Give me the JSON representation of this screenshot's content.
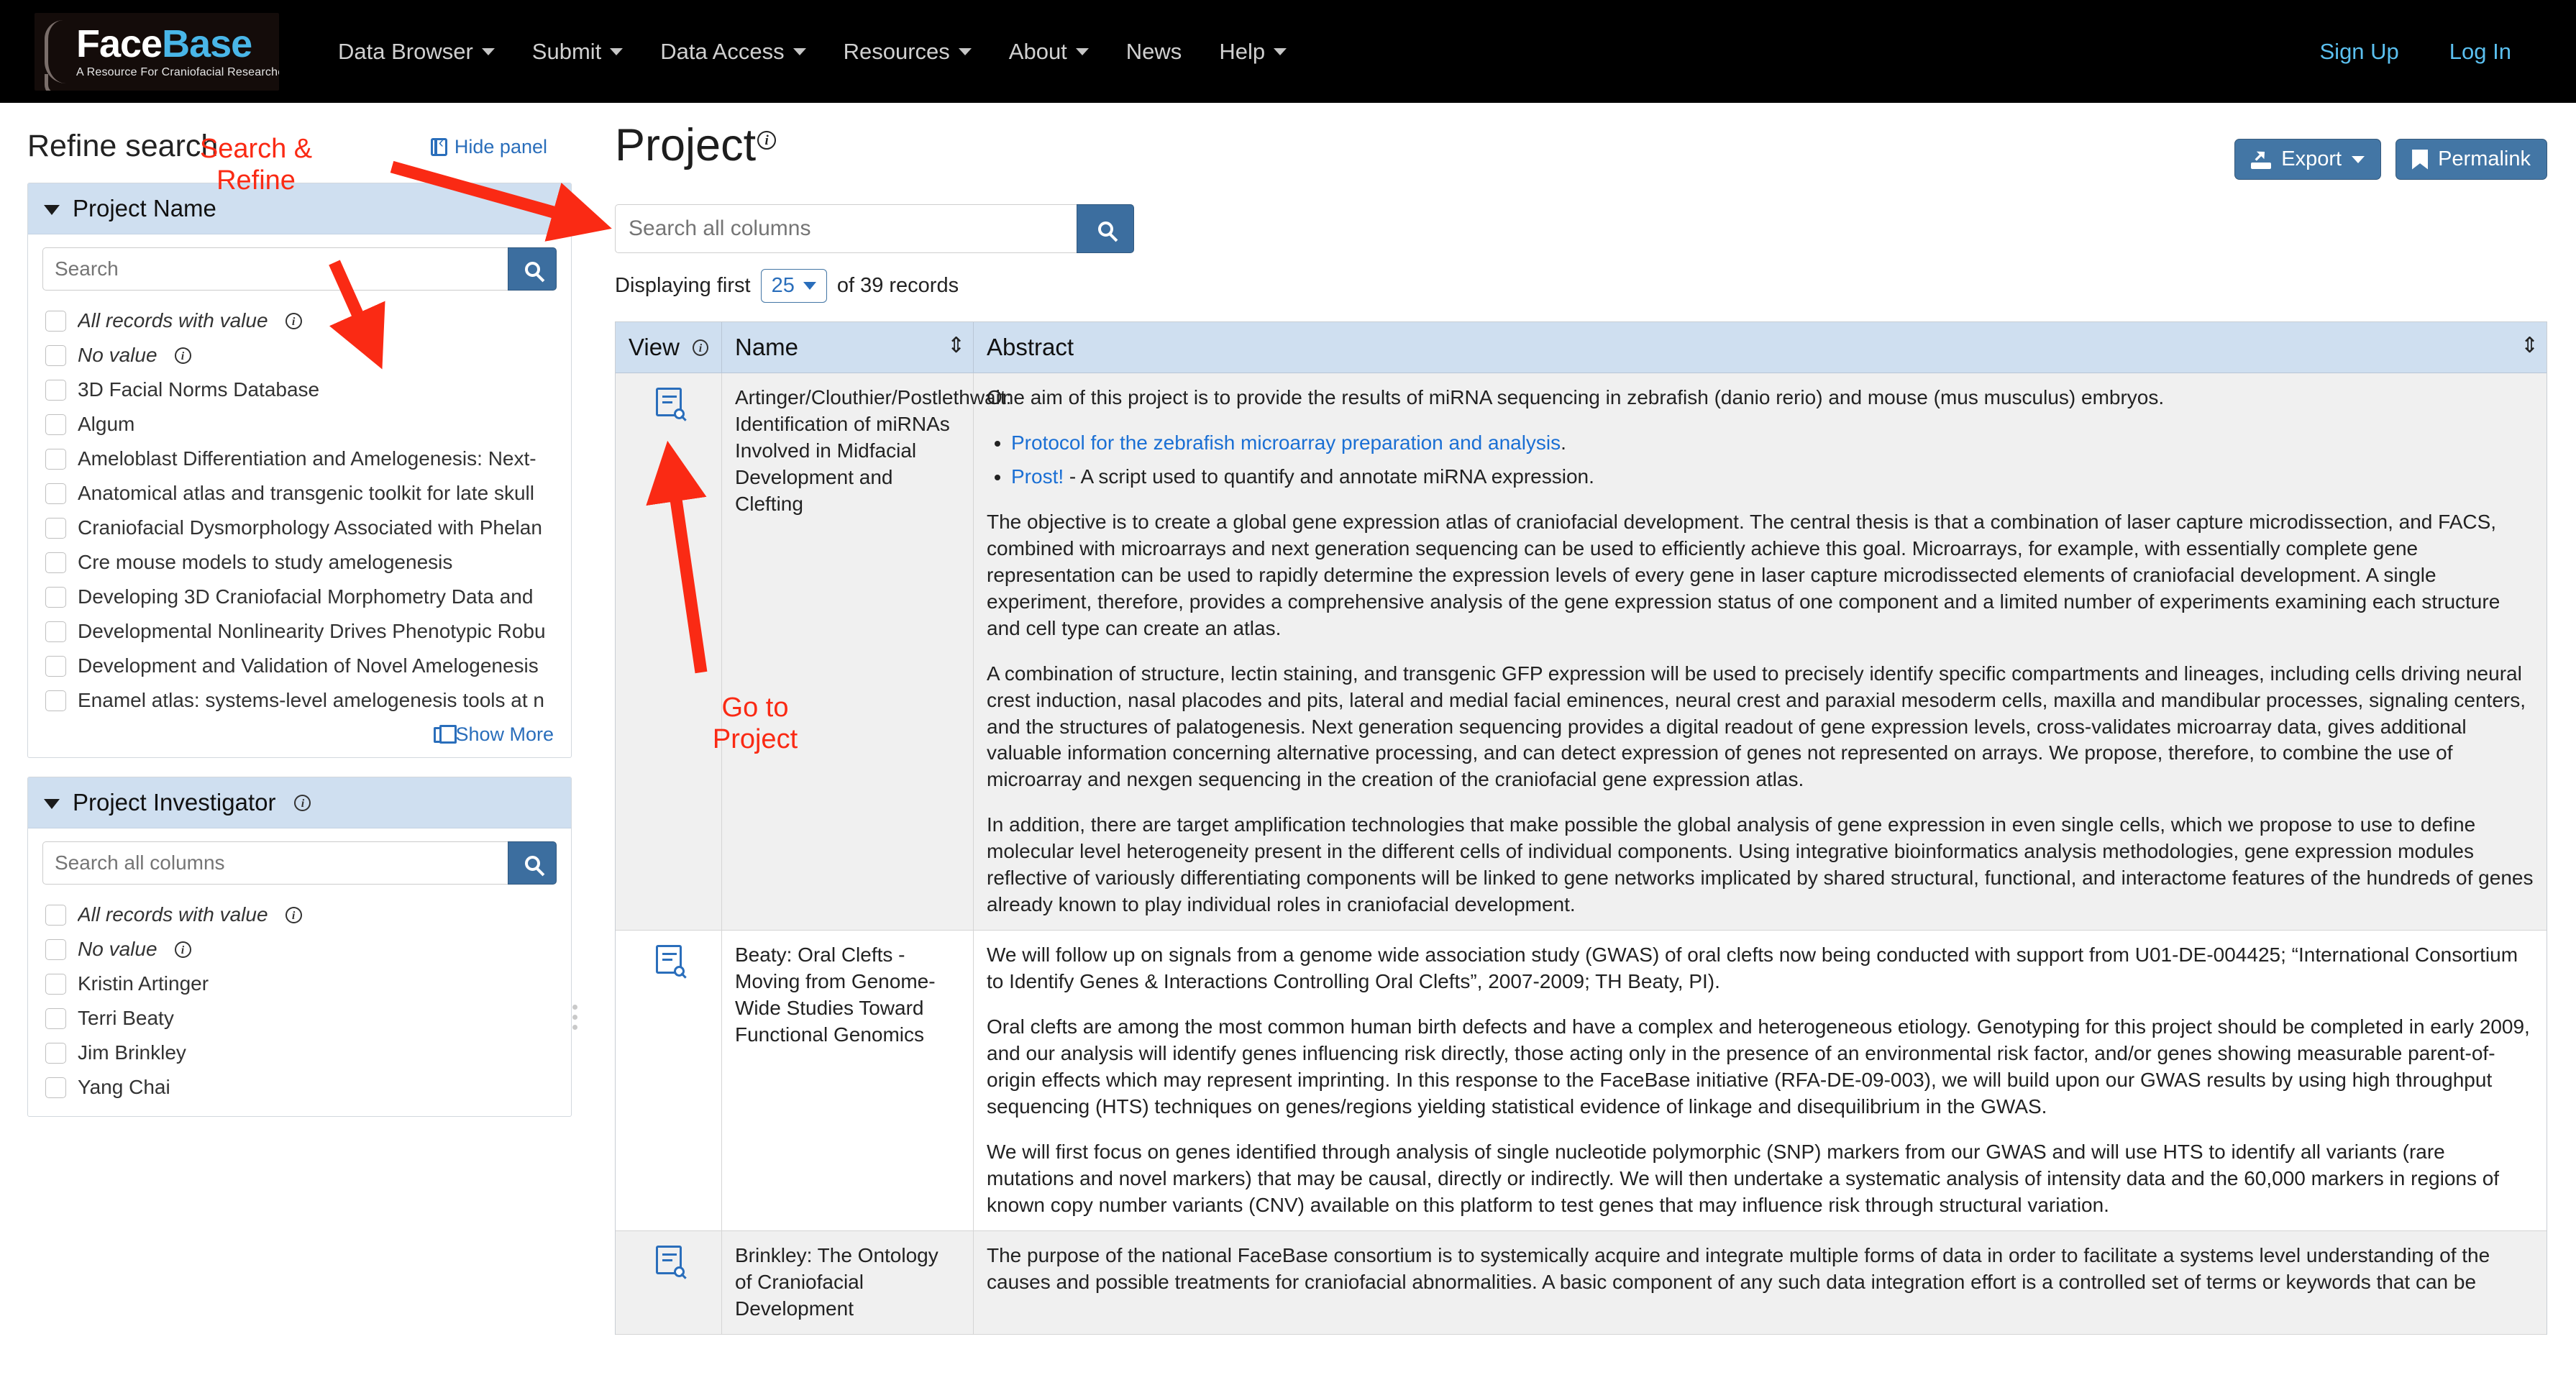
{
  "navbar": {
    "brand": {
      "word1": "Face",
      "word2": "Base",
      "tagline": "A Resource For Craniofacial Researchers"
    },
    "items": [
      {
        "label": "Data Browser",
        "has_caret": true
      },
      {
        "label": "Submit",
        "has_caret": true
      },
      {
        "label": "Data Access",
        "has_caret": true
      },
      {
        "label": "Resources",
        "has_caret": true
      },
      {
        "label": "About",
        "has_caret": true
      },
      {
        "label": "News",
        "has_caret": false
      },
      {
        "label": "Help",
        "has_caret": true
      }
    ],
    "auth": [
      {
        "label": "Sign Up"
      },
      {
        "label": "Log In"
      }
    ],
    "link_color": "#5bc0f0",
    "background": "#000000"
  },
  "sidebar": {
    "title": "Refine search",
    "hide_panel_label": "Hide panel",
    "facets": [
      {
        "title": "Project Name",
        "has_info": false,
        "search_placeholder": "Search",
        "options": [
          {
            "label": "All records with value",
            "italic": true,
            "info": true
          },
          {
            "label": "No value",
            "italic": true,
            "info": true
          },
          {
            "label": "3D Facial Norms Database",
            "italic": false,
            "info": false
          },
          {
            "label": "Algum",
            "italic": false,
            "info": false
          },
          {
            "label": "Ameloblast Differentiation and Amelogenesis: Next-",
            "italic": false,
            "info": false
          },
          {
            "label": "Anatomical atlas and transgenic toolkit for late skull",
            "italic": false,
            "info": false
          },
          {
            "label": "Craniofacial Dysmorphology Associated with Phelan",
            "italic": false,
            "info": false
          },
          {
            "label": "Cre mouse models to study amelogenesis",
            "italic": false,
            "info": false
          },
          {
            "label": "Developing 3D Craniofacial Morphometry Data and ",
            "italic": false,
            "info": false
          },
          {
            "label": "Developmental Nonlinearity Drives Phenotypic Robu",
            "italic": false,
            "info": false
          },
          {
            "label": "Development and Validation of Novel Amelogenesis",
            "italic": false,
            "info": false
          },
          {
            "label": "Enamel atlas: systems-level amelogenesis tools at n",
            "italic": false,
            "info": false
          }
        ],
        "show_more_label": "Show More"
      },
      {
        "title": "Project Investigator",
        "has_info": true,
        "search_placeholder": "Search all columns",
        "options": [
          {
            "label": "All records with value",
            "italic": true,
            "info": true
          },
          {
            "label": "No value",
            "italic": true,
            "info": true
          },
          {
            "label": "Kristin Artinger",
            "italic": false,
            "info": false
          },
          {
            "label": "Terri Beaty",
            "italic": false,
            "info": false
          },
          {
            "label": "Jim Brinkley",
            "italic": false,
            "info": false
          },
          {
            "label": "Yang Chai",
            "italic": false,
            "info": false
          }
        ],
        "show_more_label": ""
      }
    ]
  },
  "main": {
    "page_title": "Project",
    "export_label": "Export",
    "permalink_label": "Permalink",
    "search_placeholder": "Search all columns",
    "search_value": "",
    "displaying_prefix": "Displaying first",
    "page_size": "25",
    "displaying_suffix": "of 39 records",
    "columns": [
      {
        "key": "view",
        "label": "View",
        "info": true,
        "sortable": false
      },
      {
        "key": "name",
        "label": "Name",
        "info": false,
        "sortable": true
      },
      {
        "key": "abstract",
        "label": "Abstract",
        "info": false,
        "sortable": true
      }
    ],
    "rows": [
      {
        "name": "Artinger/Clouthier/Postlethwait: Identification of miRNAs Involved in Midfacial Development and Clefting",
        "abstract_intro": "One aim of this project is to provide the results of miRNA sequencing in zebrafish (danio rerio) and mouse (mus musculus) embryos.",
        "abstract_links": [
          {
            "link": "Protocol for the zebrafish microarray preparation and analysis",
            "tail": "."
          },
          {
            "link": "Prost!",
            "tail": " - A script used to quantify and annotate miRNA expression."
          }
        ],
        "paragraphs": [
          "The objective is to create a global gene expression atlas of craniofacial development. The central thesis is that a combination of laser capture microdissection, and FACS, combined with microarrays and next generation sequencing can be used to efficiently achieve this goal. Microarrays, for example, with essentially complete gene representation can be used to rapidly determine the expression levels of every gene in laser capture microdissected elements of craniofacial development. A single experiment, therefore, provides a comprehensive analysis of the gene expression status of one component and a limited number of experiments examining each structure and cell type can create an atlas.",
          "A combination of structure, lectin staining, and transgenic GFP expression will be used to precisely identify specific compartments and lineages, including cells driving neural crest induction, nasal placodes and pits, lateral and medial facial eminences, neural crest and paraxial mesoderm cells, maxilla and mandibular processes, signaling centers, and the structures of palatogenesis. Next generation sequencing provides a digital readout of gene expression levels, cross-validates microarray data, gives additional valuable information concerning alternative processing, and can detect expression of genes not represented on arrays. We propose, therefore, to combine the use of microarray and nexgen sequencing in the creation of the craniofacial gene expression atlas.",
          "In addition, there are target amplification technologies that make possible the global analysis of gene expression in even single cells, which we propose to use to define molecular level heterogeneity present in the different cells of individual components. Using integrative bioinformatics analysis methodologies, gene expression modules reflective of variously differentiating components will be linked to gene networks implicated by shared structural, functional, and interactome features of the hundreds of genes already known to play individual roles in craniofacial development."
        ],
        "shaded": true
      },
      {
        "name": "Beaty: Oral Clefts - Moving from Genome-Wide Studies Toward Functional Genomics",
        "abstract_intro": "",
        "abstract_links": [],
        "paragraphs": [
          "We will follow up on signals from a genome wide association study (GWAS) of oral clefts now being conducted with support from U01-DE-004425; “International Consortium to Identify Genes & Interactions Controlling Oral Clefts”, 2007-2009; TH Beaty, PI).",
          "Oral clefts are among the most common human birth defects and have a complex and heterogeneous etiology. Genotyping for this project should be completed in early 2009, and our analysis will identify genes influencing risk directly, those acting only in the presence of an environmental risk factor, and/or genes showing measurable parent-of-origin effects which may represent imprinting. In this response to the FaceBase initiative (RFA-DE-09-003), we will build upon our GWAS results by using high throughput sequencing (HTS) techniques on genes/regions yielding statistical evidence of linkage and disequilibrium in the GWAS.",
          "We will first focus on genes identified through analysis of single nucleotide polymorphic (SNP) markers from our GWAS and will use HTS to identify all variants (rare mutations and novel markers) that may be causal, directly or indirectly. We will then undertake a systematic analysis of intensity data and the 60,000 markers in regions of known copy number variants (CNV) available on this platform to test genes that may influence risk through structural variation."
        ],
        "shaded": false
      },
      {
        "name": "Brinkley: The Ontology of Craniofacial Development",
        "abstract_intro": "",
        "abstract_links": [],
        "paragraphs": [
          "The purpose of the national FaceBase consortium is to systemically acquire and integrate multiple forms of data in order to facilitate a systems level understanding of the causes and possible treatments for craniofacial abnormalities. A basic component of any such data integration effort is a controlled set of terms or keywords that can be"
        ],
        "shaded": true
      }
    ]
  },
  "annotations": [
    {
      "id": "search-refine",
      "text": "Search & Refine",
      "color": "#fa2a14"
    },
    {
      "id": "goto-project",
      "text": "Go to Project",
      "color": "#fa2a14"
    }
  ]
}
